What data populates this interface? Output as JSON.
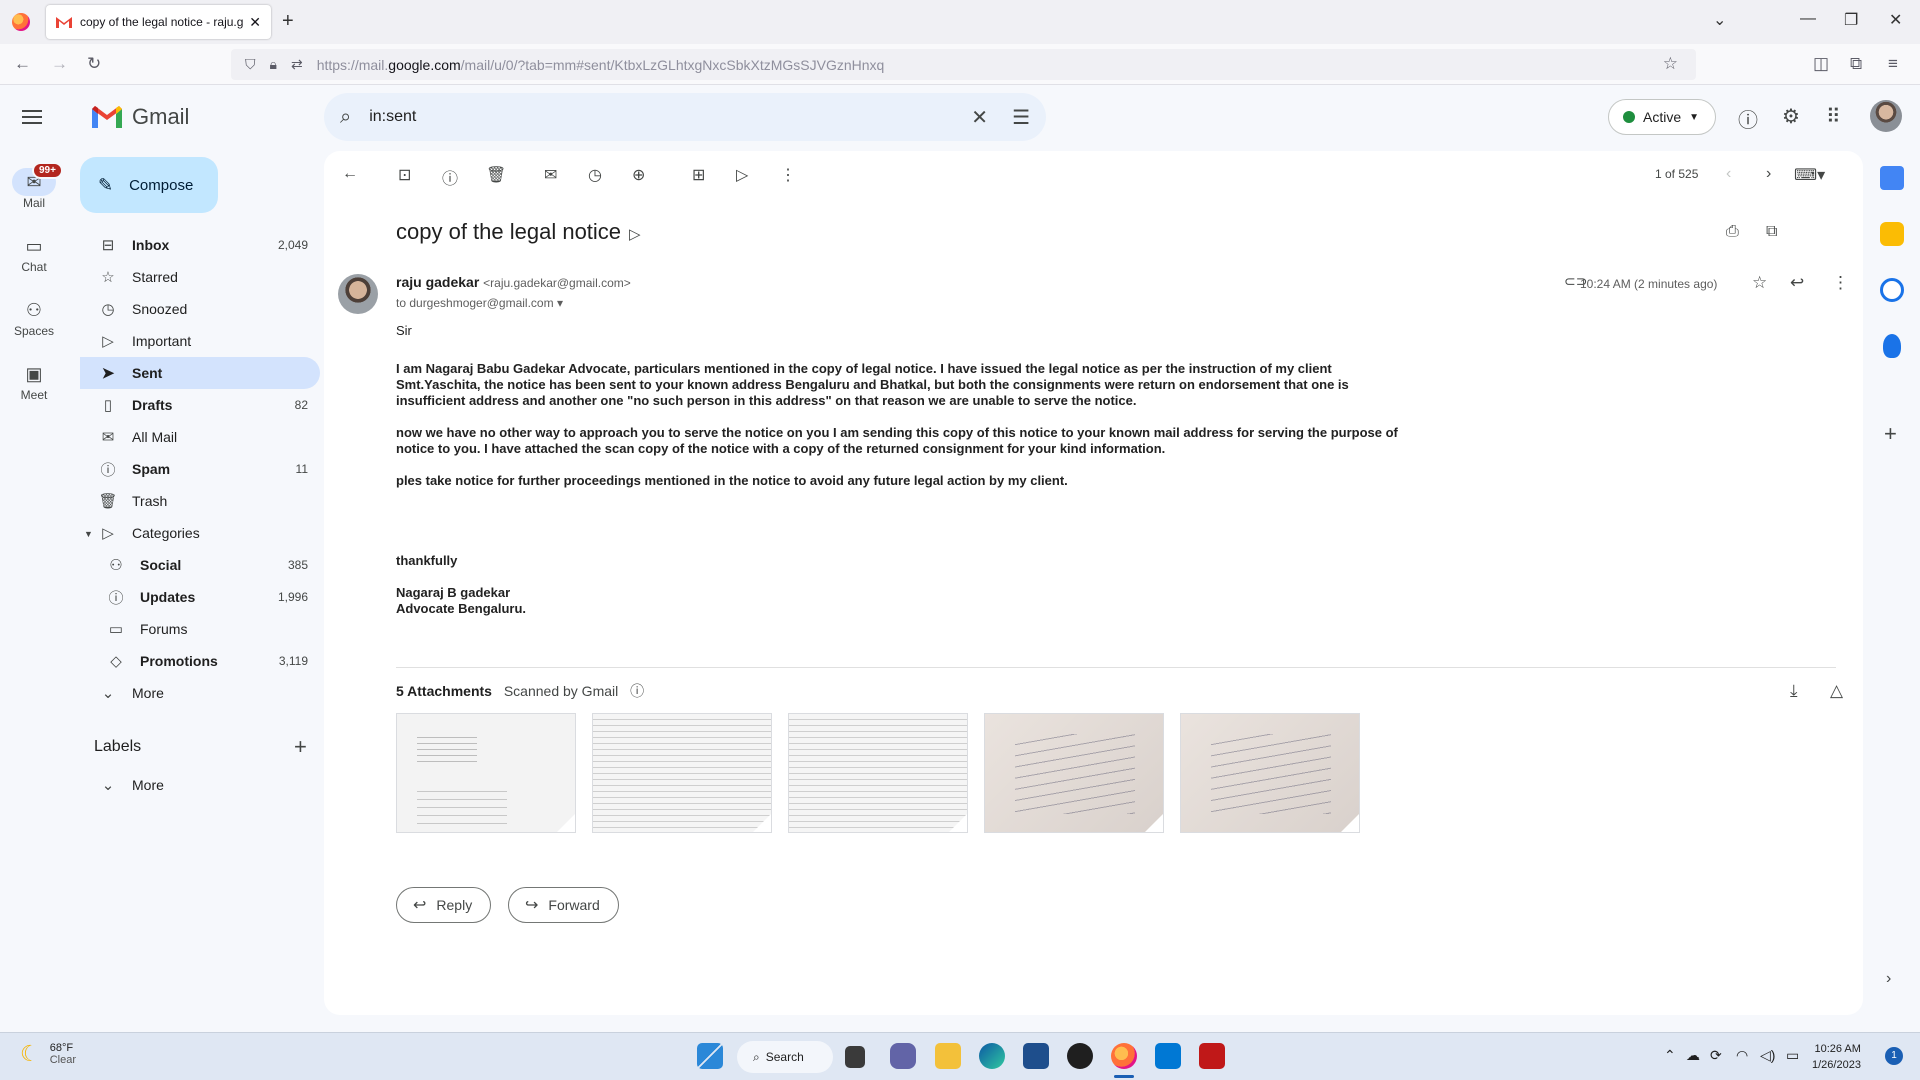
{
  "browser": {
    "tab_title": "copy of the legal notice - raju.g",
    "url_prefix": "https://mail.",
    "url_domain": "google.com",
    "url_rest": "/mail/u/0/?tab=mm#sent/KtbxLzGLhtxgNxcSbkXtzMGsSJVGznHnxq"
  },
  "gmail": {
    "logo_text": "Gmail",
    "search_query": "in:sent",
    "status": "Active",
    "compose_label": "Compose",
    "rail": [
      {
        "label": "Mail",
        "badge": "99+"
      },
      {
        "label": "Chat"
      },
      {
        "label": "Spaces"
      },
      {
        "label": "Meet"
      }
    ],
    "nav": [
      {
        "label": "Inbox",
        "count": "2,049"
      },
      {
        "label": "Starred",
        "count": ""
      },
      {
        "label": "Snoozed",
        "count": ""
      },
      {
        "label": "Important",
        "count": ""
      },
      {
        "label": "Sent",
        "count": ""
      },
      {
        "label": "Drafts",
        "count": "82"
      },
      {
        "label": "All Mail",
        "count": ""
      },
      {
        "label": "Spam",
        "count": "11"
      },
      {
        "label": "Trash",
        "count": ""
      },
      {
        "label": "Categories",
        "count": ""
      }
    ],
    "categories": [
      {
        "label": "Social",
        "count": "385"
      },
      {
        "label": "Updates",
        "count": "1,996"
      },
      {
        "label": "Forums",
        "count": ""
      },
      {
        "label": "Promotions",
        "count": "3,119"
      }
    ],
    "more_label": "More",
    "labels_header": "Labels",
    "labels_more": "More"
  },
  "message": {
    "pager": "1 of 525",
    "subject": "copy of the legal notice",
    "sender_name": "raju gadekar",
    "sender_email": "<raju.gadekar@gmail.com>",
    "to": "to durgeshmoger@gmail.com",
    "time": "10:24 AM (2 minutes ago)",
    "body": {
      "greeting": "Sir",
      "p1_l1": "I am Nagaraj Babu Gadekar Advocate, particulars mentioned in the copy of legal notice. I have issued the legal notice as per the instruction of my client",
      "p1_l2": "Smt.Yaschita, the notice has been sent to your known address Bengaluru and Bhatkal, but both the consignments were return on endorsement that one is",
      "p1_l3": "insufficient address and another one \"no such person in this address\" on that reason we are unable to serve the notice.",
      "p2_l1": "now we have no other way to approach you to serve the notice on you  I am sending this copy of this notice to your known mail address for serving the purpose of",
      "p2_l2": "notice to you. I have attached the scan copy of the notice with a copy of the returned consignment for your kind information.",
      "p3": "ples take notice for further proceedings mentioned in the notice to avoid any future legal action  by my client.",
      "closing": "thankfully",
      "sig1": "Nagaraj B gadekar",
      "sig2": "Advocate Bengaluru."
    },
    "attachments_label": "5 Attachments",
    "scanned_label": "Scanned by Gmail",
    "reply_label": "Reply",
    "forward_label": "Forward"
  },
  "taskbar": {
    "temp": "68°F",
    "condition": "Clear",
    "search_label": "Search",
    "time": "10:26 AM",
    "date": "1/26/2023",
    "notifications": "1"
  },
  "colors": {
    "compose_bg": "#c2e7ff",
    "selected_nav": "#d3e3fd",
    "search_bg": "#eaf1fb",
    "active_dot": "#1e8e3e",
    "badge": "#b3261e"
  }
}
